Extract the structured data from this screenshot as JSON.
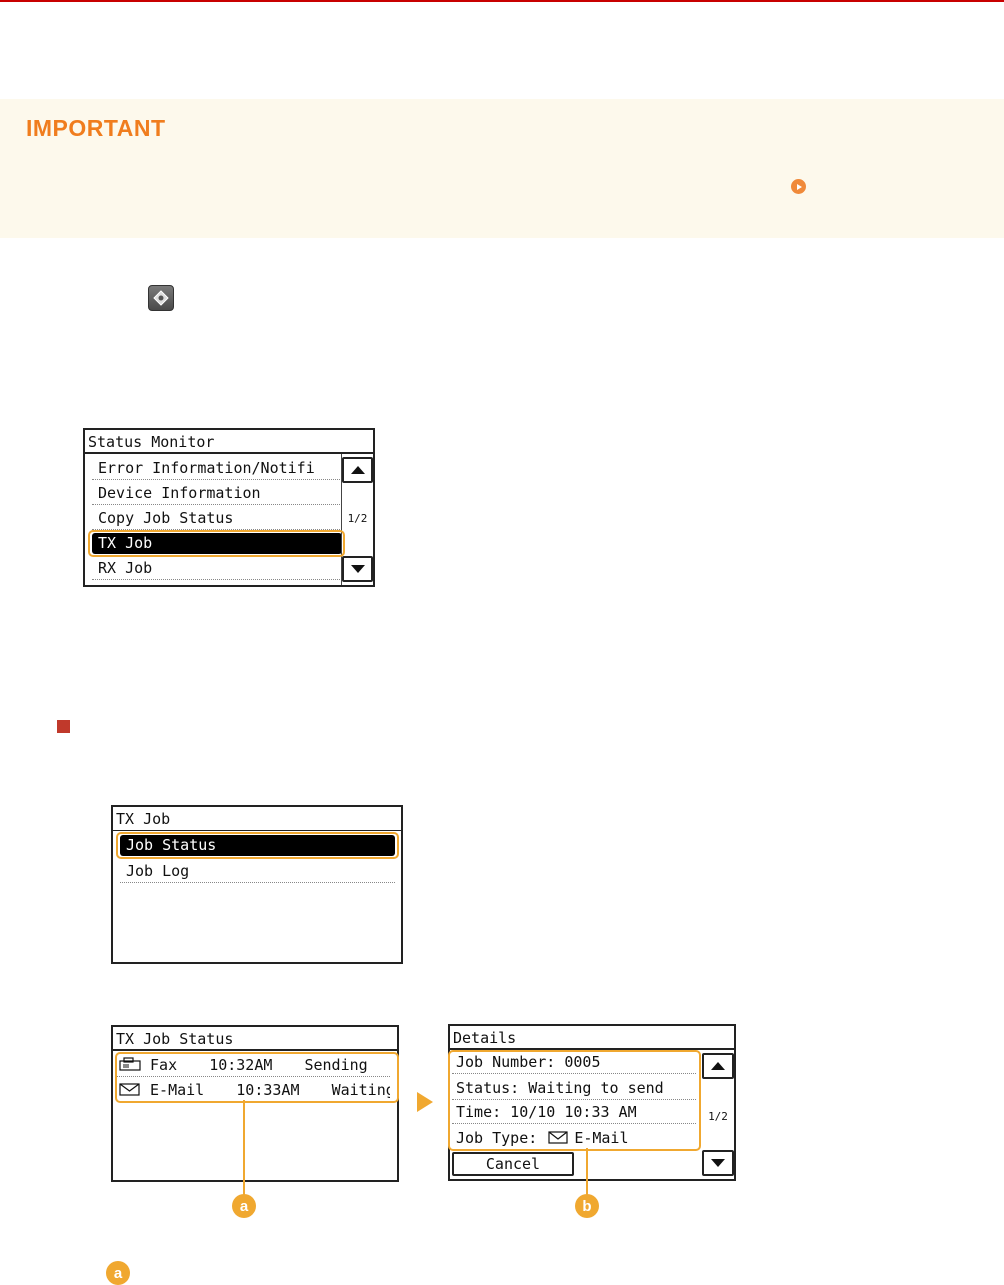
{
  "important": {
    "title": "IMPORTANT"
  },
  "status_monitor": {
    "title": "Status Monitor",
    "items": [
      "Error Information/Notifi",
      "Device Information",
      "Copy Job Status",
      "TX Job",
      "RX Job"
    ],
    "page": "1/2"
  },
  "tx_job": {
    "title": "TX Job",
    "items": [
      "Job Status",
      "Job Log"
    ]
  },
  "tx_job_status": {
    "title": "TX Job Status",
    "rows": [
      {
        "type": "Fax",
        "time": "10:32AM",
        "state": "Sending"
      },
      {
        "type": "E-Mail",
        "time": "10:33AM",
        "state": "Waiting"
      }
    ]
  },
  "details": {
    "title": "Details",
    "rows": [
      "Job Number: 0005",
      "Status: Waiting to send",
      "Time: 10/10 10:33 AM",
      "Job Type: "
    ],
    "job_type_value": "E-Mail",
    "page": "1/2",
    "cancel": "Cancel"
  },
  "callouts": {
    "a": "a",
    "b": "b"
  },
  "colors": {
    "accent": "#f0a830",
    "important_title": "#f07d1e",
    "rule": "#c80000",
    "bullet": "#c0392b"
  }
}
